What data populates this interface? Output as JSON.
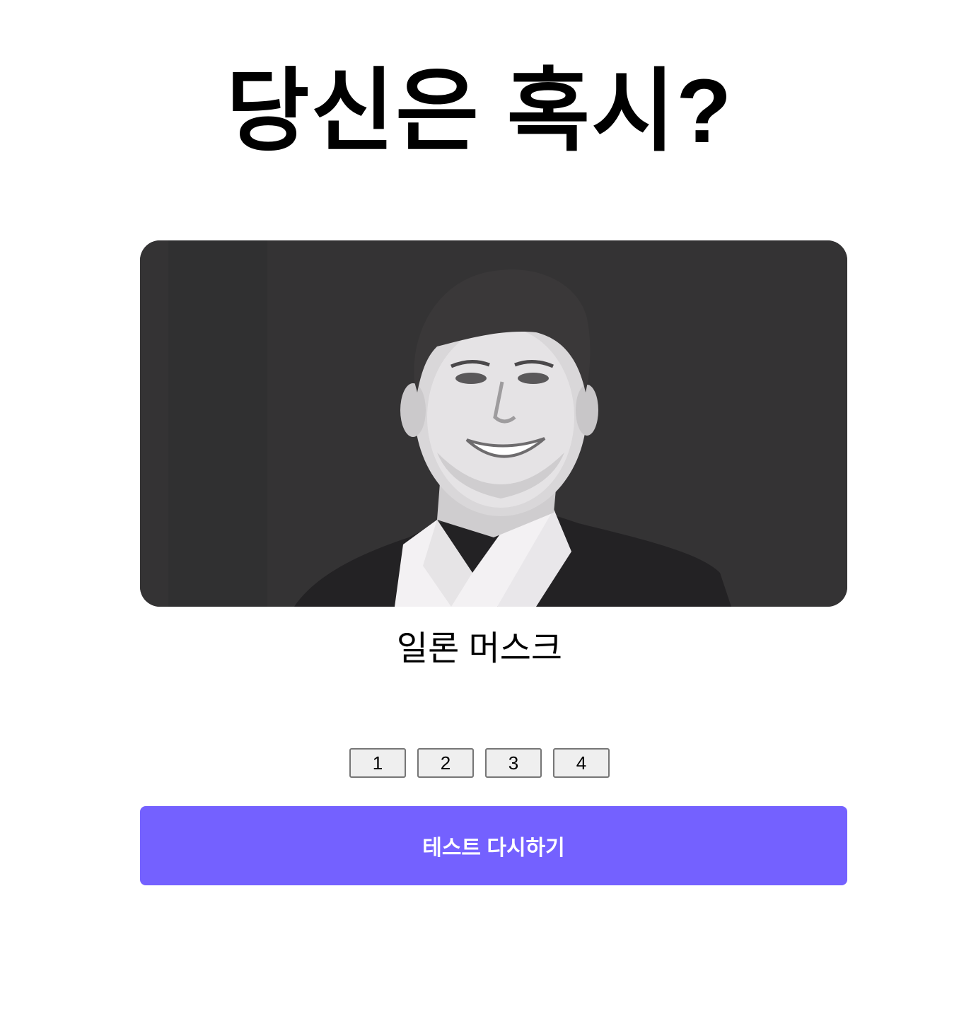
{
  "header": {
    "title": "당신은 혹시?"
  },
  "result": {
    "image_alt": "일론 머스크",
    "name": "일론 머스크"
  },
  "pagination": {
    "pages": [
      "1",
      "2",
      "3",
      "4"
    ]
  },
  "actions": {
    "retry_label": "테스트 다시하기"
  },
  "colors": {
    "accent": "#7461ff",
    "photo_background": "#343334",
    "text": "#000000"
  },
  "icons": {
    "portrait": "person-photo"
  }
}
